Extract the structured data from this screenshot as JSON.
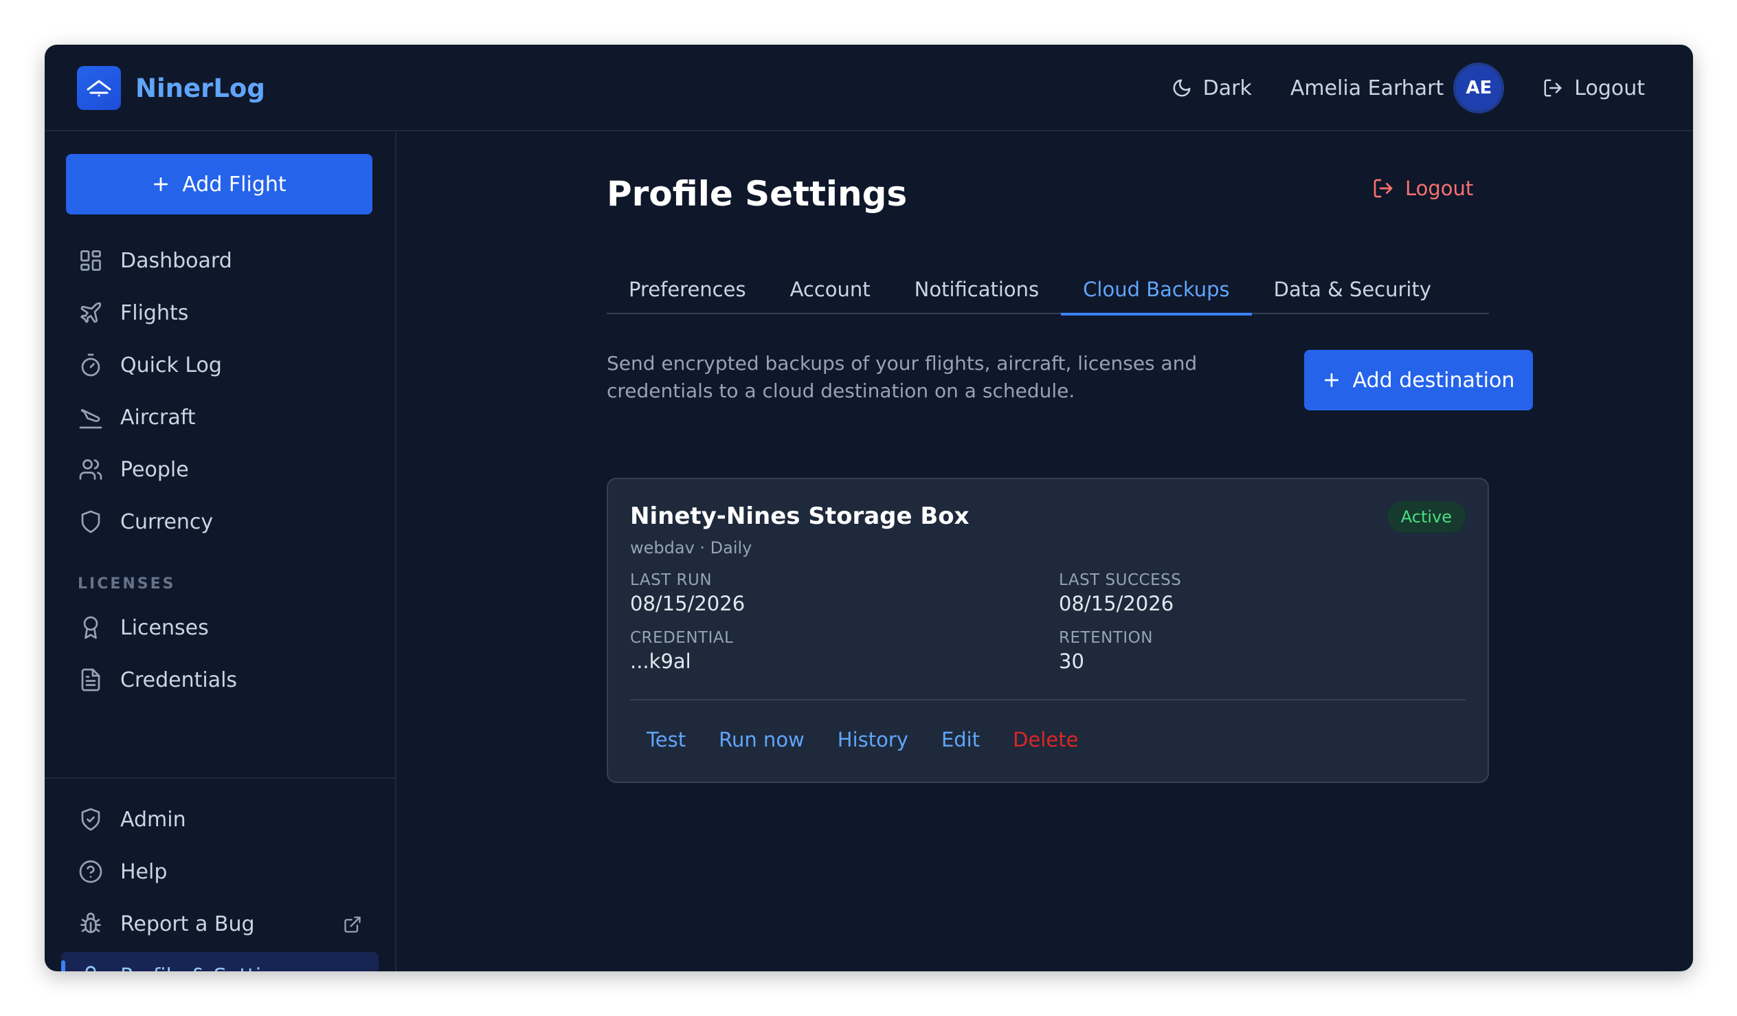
{
  "app": {
    "name": "NinerLog"
  },
  "topbar": {
    "theme_label": "Dark",
    "user_name": "Amelia Earhart",
    "avatar_initials": "AE",
    "logout_label": "Logout"
  },
  "sidebar": {
    "add_flight_label": "Add Flight",
    "items": [
      {
        "label": "Dashboard",
        "icon": "dashboard-icon"
      },
      {
        "label": "Flights",
        "icon": "plane-icon"
      },
      {
        "label": "Quick Log",
        "icon": "timer-icon"
      },
      {
        "label": "Aircraft",
        "icon": "plane-landing-icon"
      },
      {
        "label": "People",
        "icon": "users-icon"
      },
      {
        "label": "Currency",
        "icon": "shield-icon"
      }
    ],
    "section_label": "LICENSES",
    "license_items": [
      {
        "label": "Licenses",
        "icon": "award-icon"
      },
      {
        "label": "Credentials",
        "icon": "document-icon"
      }
    ],
    "bottom_items": [
      {
        "label": "Admin",
        "icon": "shield-check-icon"
      },
      {
        "label": "Help",
        "icon": "help-circle-icon"
      },
      {
        "label": "Report a Bug",
        "icon": "bug-icon"
      },
      {
        "label": "Profile & Settings",
        "icon": "user-icon",
        "active": true
      }
    ]
  },
  "main": {
    "title": "Profile Settings",
    "logout_label": "Logout",
    "tabs": [
      {
        "label": "Preferences"
      },
      {
        "label": "Account"
      },
      {
        "label": "Notifications"
      },
      {
        "label": "Cloud Backups",
        "active": true
      },
      {
        "label": "Data & Security"
      }
    ],
    "intro": "Send encrypted backups of your flights, aircraft, licenses and credentials to a cloud destination on a schedule.",
    "add_destination_label": "Add destination",
    "destination": {
      "name": "Ninety-Nines Storage Box",
      "subtitle": "webdav · Daily",
      "status": "Active",
      "last_run_label": "LAST RUN",
      "last_run": "08/15/2026",
      "last_success_label": "LAST SUCCESS",
      "last_success": "08/15/2026",
      "credential_label": "CREDENTIAL",
      "credential": "...k9al",
      "retention_label": "RETENTION",
      "retention": "30",
      "actions": {
        "test": "Test",
        "run_now": "Run now",
        "history": "History",
        "edit": "Edit",
        "delete": "Delete"
      }
    }
  },
  "colors": {
    "accent": "#2563eb",
    "link": "#60a5fa",
    "danger": "#dc2626",
    "success": "#4ade80",
    "background": "#0f172a",
    "card": "#1e293b"
  }
}
